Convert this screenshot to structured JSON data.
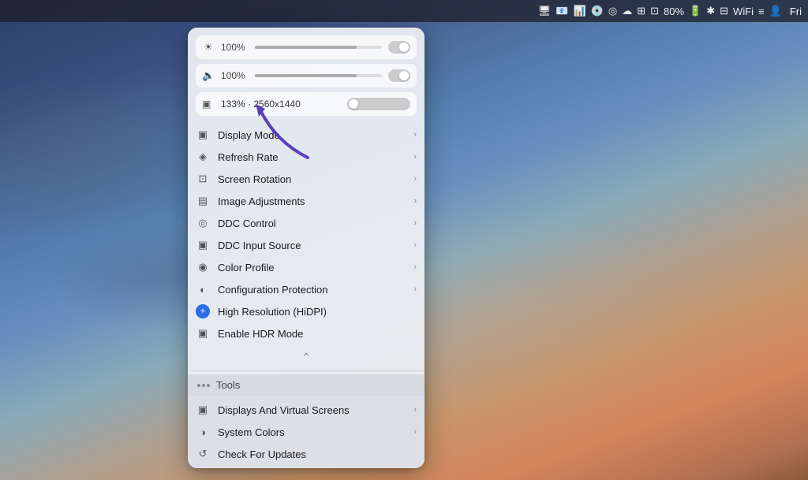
{
  "menubar": {
    "time": "Fri",
    "battery": "80%",
    "icons": [
      "monitor-icon",
      "mail-icon",
      "graph-icon",
      "disk-icon",
      "circle-icon",
      "cloud-icon",
      "grid-icon",
      "cast-icon",
      "battery-icon",
      "bluetooth-icon",
      "display-icon",
      "wifi-icon",
      "control-icon",
      "avatar-icon"
    ]
  },
  "sliders": {
    "brightness": {
      "icon": "☀",
      "value": "100%",
      "percent": 100
    },
    "volume": {
      "icon": "🔈",
      "value": "100%",
      "percent": 100
    },
    "resolution": {
      "icon": "▣",
      "label": "133% · 2560x1440"
    }
  },
  "menu_items": [
    {
      "id": "display-mode",
      "icon": "▣",
      "label": "Display Mode",
      "has_arrow": true
    },
    {
      "id": "refresh-rate",
      "icon": "◈",
      "label": "Refresh Rate",
      "has_arrow": true
    },
    {
      "id": "screen-rotation",
      "icon": "⊡",
      "label": "Screen Rotation",
      "has_arrow": true
    },
    {
      "id": "image-adjustments",
      "icon": "▤",
      "label": "Image Adjustments",
      "has_arrow": true
    },
    {
      "id": "ddc-control",
      "icon": "◎",
      "label": "DDC Control",
      "has_arrow": true
    },
    {
      "id": "ddc-input-source",
      "icon": "▣",
      "label": "DDC Input Source",
      "has_arrow": true
    },
    {
      "id": "color-profile",
      "icon": "◉",
      "label": "Color Profile",
      "has_arrow": true
    },
    {
      "id": "configuration-protection",
      "icon": "◐",
      "label": "Configuration Protection",
      "has_arrow": true
    },
    {
      "id": "high-resolution",
      "icon": "+",
      "label": "High Resolution (HiDPI)",
      "has_arrow": false,
      "blue_icon": true
    },
    {
      "id": "enable-hdr",
      "icon": "▣",
      "label": "Enable HDR Mode",
      "has_arrow": false
    }
  ],
  "tools": {
    "label": "Tools"
  },
  "bottom_items": [
    {
      "id": "displays-virtual",
      "icon": "▣",
      "label": "Displays And Virtual Screens",
      "has_arrow": true
    },
    {
      "id": "system-colors",
      "icon": "◑",
      "label": "System Colors",
      "has_arrow": true
    },
    {
      "id": "check-updates",
      "icon": "↺",
      "label": "Check For Updates",
      "has_arrow": false
    }
  ]
}
